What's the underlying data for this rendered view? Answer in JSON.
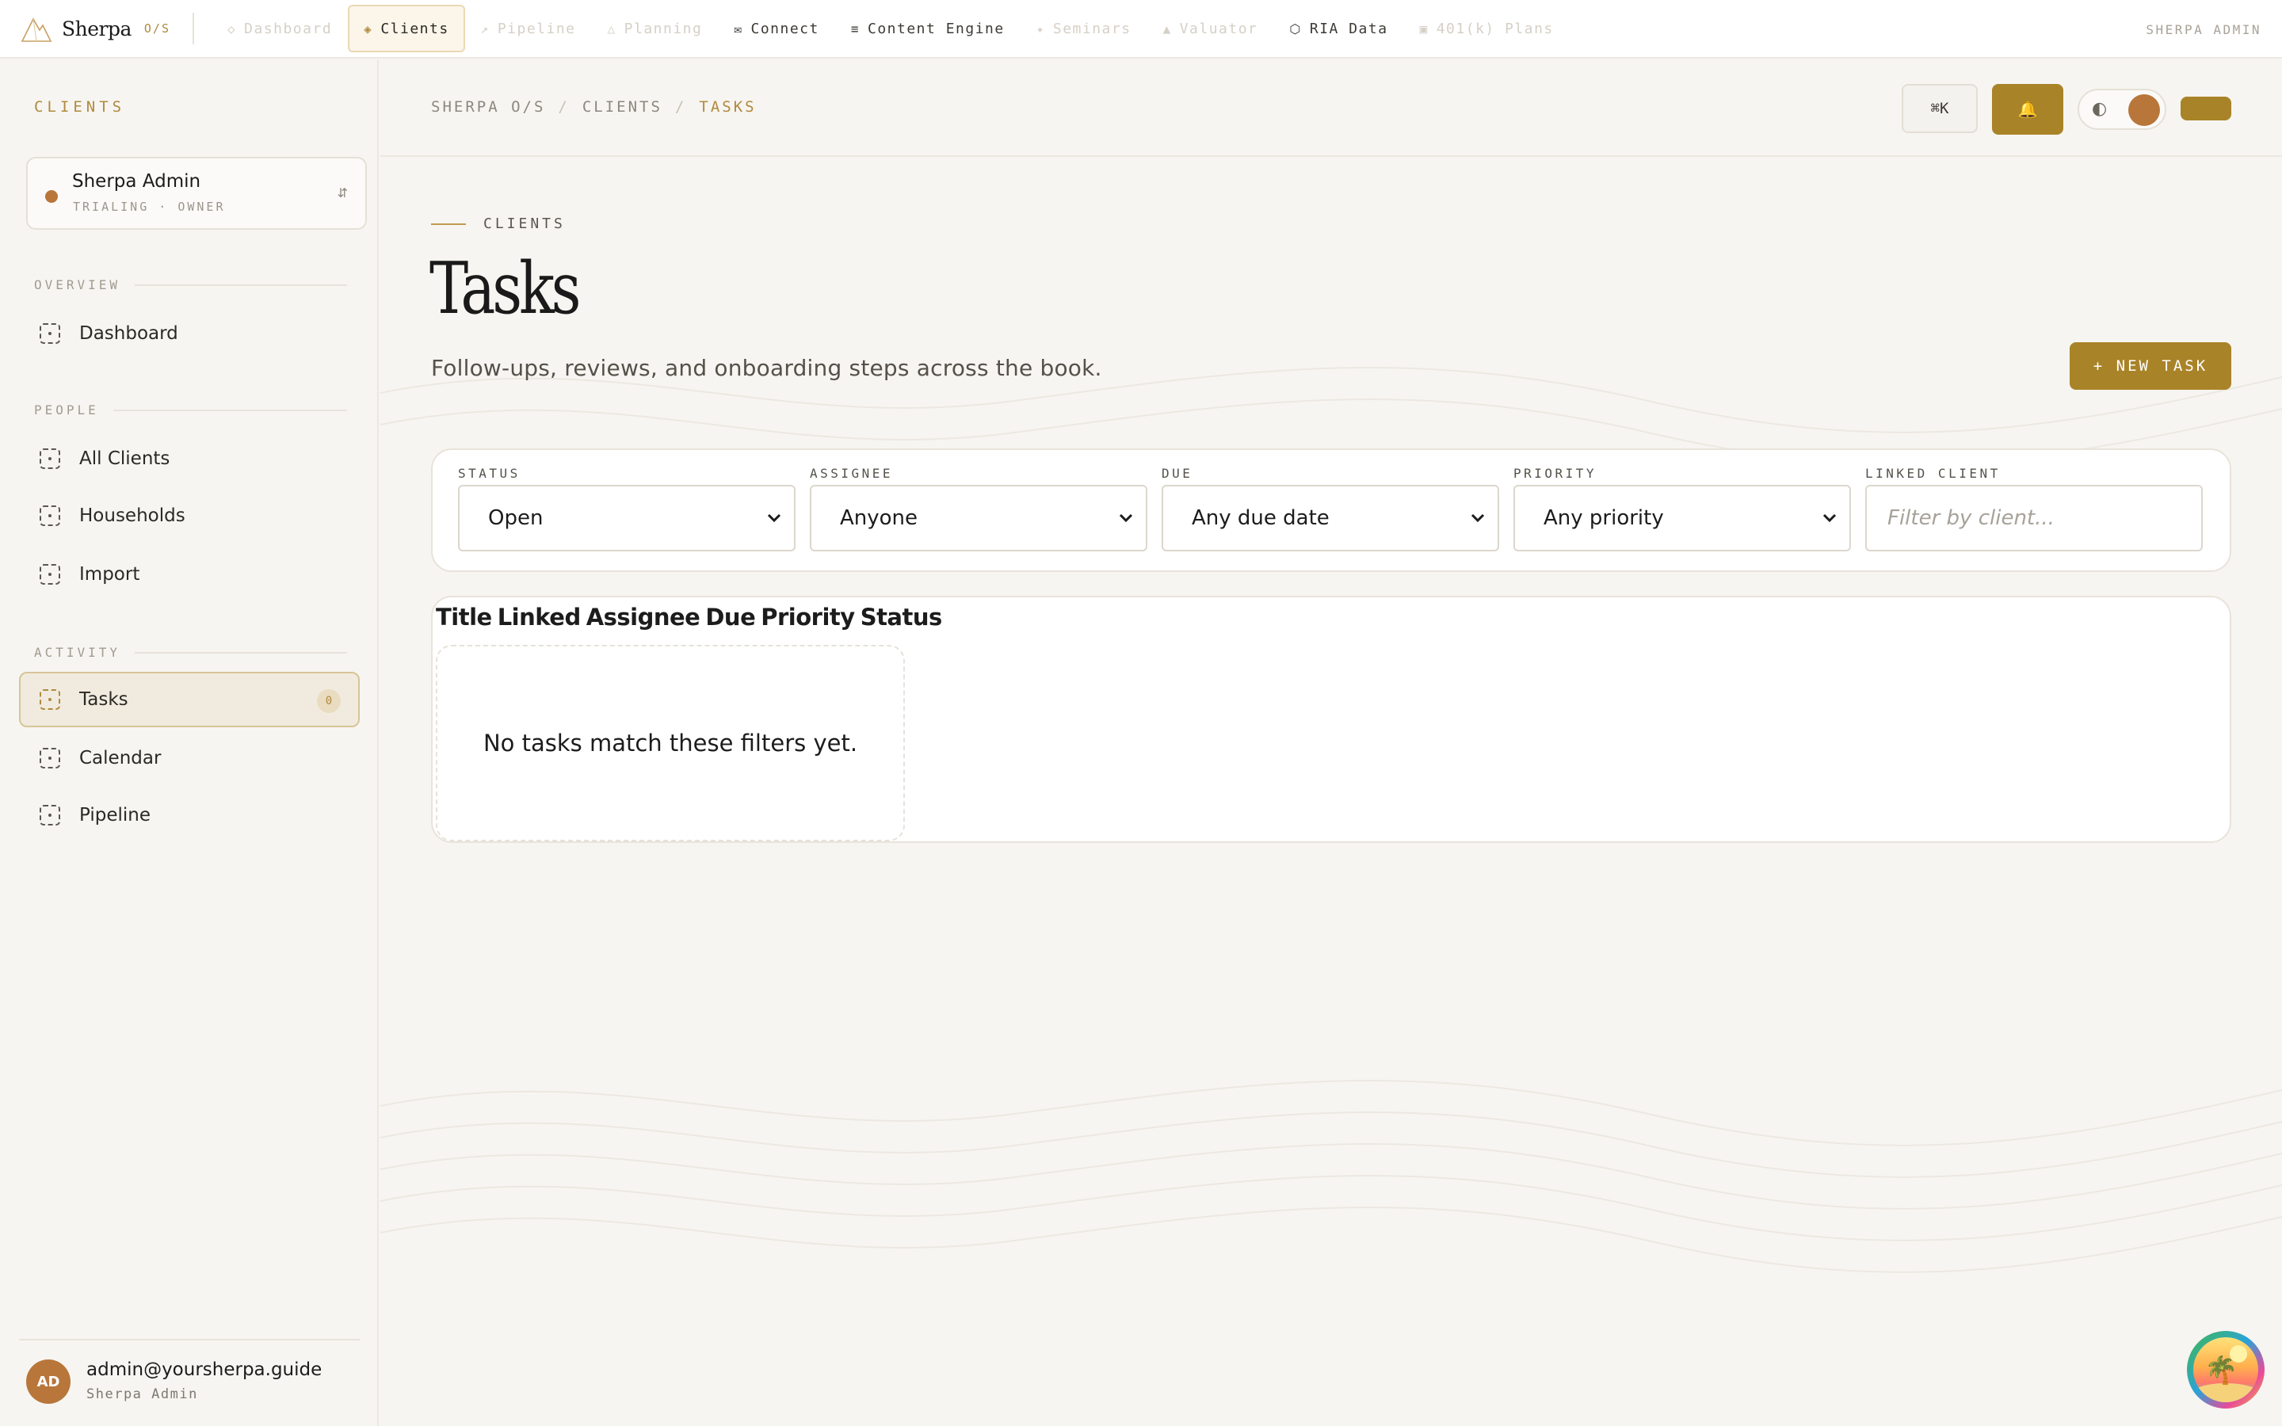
{
  "brand": {
    "name": "Sherpa",
    "suffix": "O/S"
  },
  "topnav": {
    "items": [
      {
        "icon": "◇",
        "label": "Dashboard",
        "state": "dim"
      },
      {
        "icon": "◈",
        "label": "Clients",
        "state": "active"
      },
      {
        "icon": "↗",
        "label": "Pipeline",
        "state": "dim"
      },
      {
        "icon": "△",
        "label": "Planning",
        "state": "dim"
      },
      {
        "icon": "✉",
        "label": "Connect",
        "state": "norm"
      },
      {
        "icon": "≡",
        "label": "Content Engine",
        "state": "norm"
      },
      {
        "icon": "✦",
        "label": "Seminars",
        "state": "dim"
      },
      {
        "icon": "▲",
        "label": "Valuator",
        "state": "dim"
      },
      {
        "icon": "⬡",
        "label": "RIA Data",
        "state": "norm"
      },
      {
        "icon": "▣",
        "label": "401(k) Plans",
        "state": "dim"
      }
    ],
    "user_label": "SHERPA ADMIN"
  },
  "sidebar": {
    "title": "CLIENTS",
    "org": {
      "name": "Sherpa Admin",
      "sub": "TRIALING · OWNER",
      "swap_icon": "⇵"
    },
    "sections": {
      "overview": "OVERVIEW",
      "people": "PEOPLE",
      "activity": "ACTIVITY"
    },
    "items": {
      "dashboard": "Dashboard",
      "all_clients": "All Clients",
      "households": "Households",
      "import": "Import",
      "tasks": "Tasks",
      "tasks_count": "0",
      "calendar": "Calendar",
      "pipeline": "Pipeline"
    },
    "user": {
      "initials": "AD",
      "email": "admin@yoursherpa.guide",
      "name": "Sherpa Admin"
    }
  },
  "header": {
    "breadcrumb": [
      "SHERPA O/S",
      "CLIENTS",
      "TASKS"
    ],
    "breadcrumb_sep": "/",
    "command_label": "⌘K",
    "bell_icon": "🔔",
    "theme_icon": "◐"
  },
  "page": {
    "eyebrow": "CLIENTS",
    "title": "Tasks",
    "subtitle": "Follow-ups, reviews, and onboarding steps across the book.",
    "new_button": "+ NEW TASK"
  },
  "filters": {
    "status": {
      "label": "STATUS",
      "value": "Open"
    },
    "assignee": {
      "label": "ASSIGNEE",
      "value": "Anyone"
    },
    "due": {
      "label": "DUE",
      "value": "Any due date"
    },
    "priority": {
      "label": "PRIORITY",
      "value": "Any priority"
    },
    "linked_client": {
      "label": "LINKED CLIENT",
      "placeholder": "Filter by client..."
    }
  },
  "table": {
    "columns": [
      "Title",
      "Linked",
      "Assignee",
      "Due",
      "Priority",
      "Status"
    ],
    "empty_message": "No tasks match these filters yet."
  },
  "colors": {
    "accent": "#a98327",
    "accent_text": "#b08a3e",
    "avatar": "#b8763b",
    "background": "#f7f5f1"
  }
}
